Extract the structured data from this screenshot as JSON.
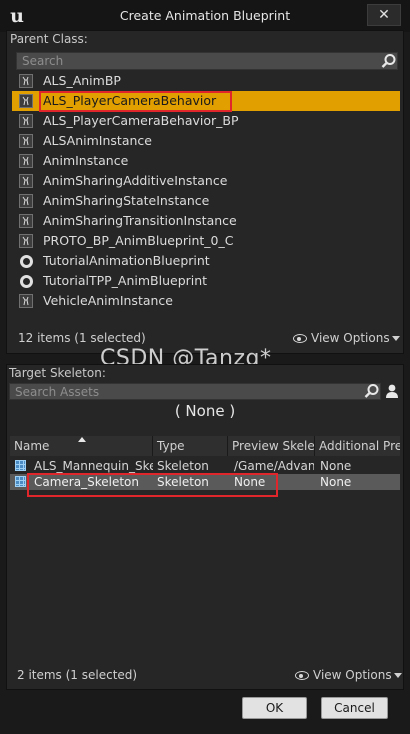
{
  "window": {
    "title": "Create Animation Blueprint",
    "close_glyph": "✕",
    "logo_glyph": "u"
  },
  "parent_class": {
    "label": "Parent Class:",
    "search_placeholder": "Search",
    "items": [
      {
        "label": "ALS_AnimBP",
        "icon": "blueprint-icon"
      },
      {
        "label": "ALS_PlayerCameraBehavior",
        "icon": "blueprint-icon",
        "selected": true
      },
      {
        "label": "ALS_PlayerCameraBehavior_BP",
        "icon": "blueprint-icon"
      },
      {
        "label": "ALSAnimInstance",
        "icon": "blueprint-icon"
      },
      {
        "label": "AnimInstance",
        "icon": "blueprint-icon"
      },
      {
        "label": "AnimSharingAdditiveInstance",
        "icon": "blueprint-icon"
      },
      {
        "label": "AnimSharingStateInstance",
        "icon": "blueprint-icon"
      },
      {
        "label": "AnimSharingTransitionInstance",
        "icon": "blueprint-icon"
      },
      {
        "label": "PROTO_BP_AnimBlueprint_0_C",
        "icon": "blueprint-icon"
      },
      {
        "label": "TutorialAnimationBlueprint",
        "icon": "ring-icon"
      },
      {
        "label": "TutorialTPP_AnimBlueprint",
        "icon": "ring-icon"
      },
      {
        "label": "VehicleAnimInstance",
        "icon": "blueprint-icon"
      }
    ],
    "count_text": "12 items (1 selected)",
    "view_options": "View Options"
  },
  "watermark": "CSDN @Tanzq*",
  "target_skeleton": {
    "label": "Target Skeleton:",
    "search_placeholder": "Search Assets",
    "current": "( None )",
    "columns": [
      "Name",
      "Type",
      "Preview Skeleta",
      "Additional Prev"
    ],
    "rows": [
      {
        "name": "ALS_Mannequin_Skele",
        "type": "Skeleton",
        "preview": "/Game/Advan",
        "additional": "None"
      },
      {
        "name": "Camera_Skeleton",
        "type": "Skeleton",
        "preview": "None",
        "additional": "None",
        "selected": true
      }
    ],
    "count_text": "2 items (1 selected)",
    "view_options": "View Options"
  },
  "buttons": {
    "ok": "OK",
    "cancel": "Cancel"
  },
  "colors": {
    "selection": "#e2a000",
    "highlight_box": "#e0262a",
    "row_selected": "#5a5a5a"
  }
}
